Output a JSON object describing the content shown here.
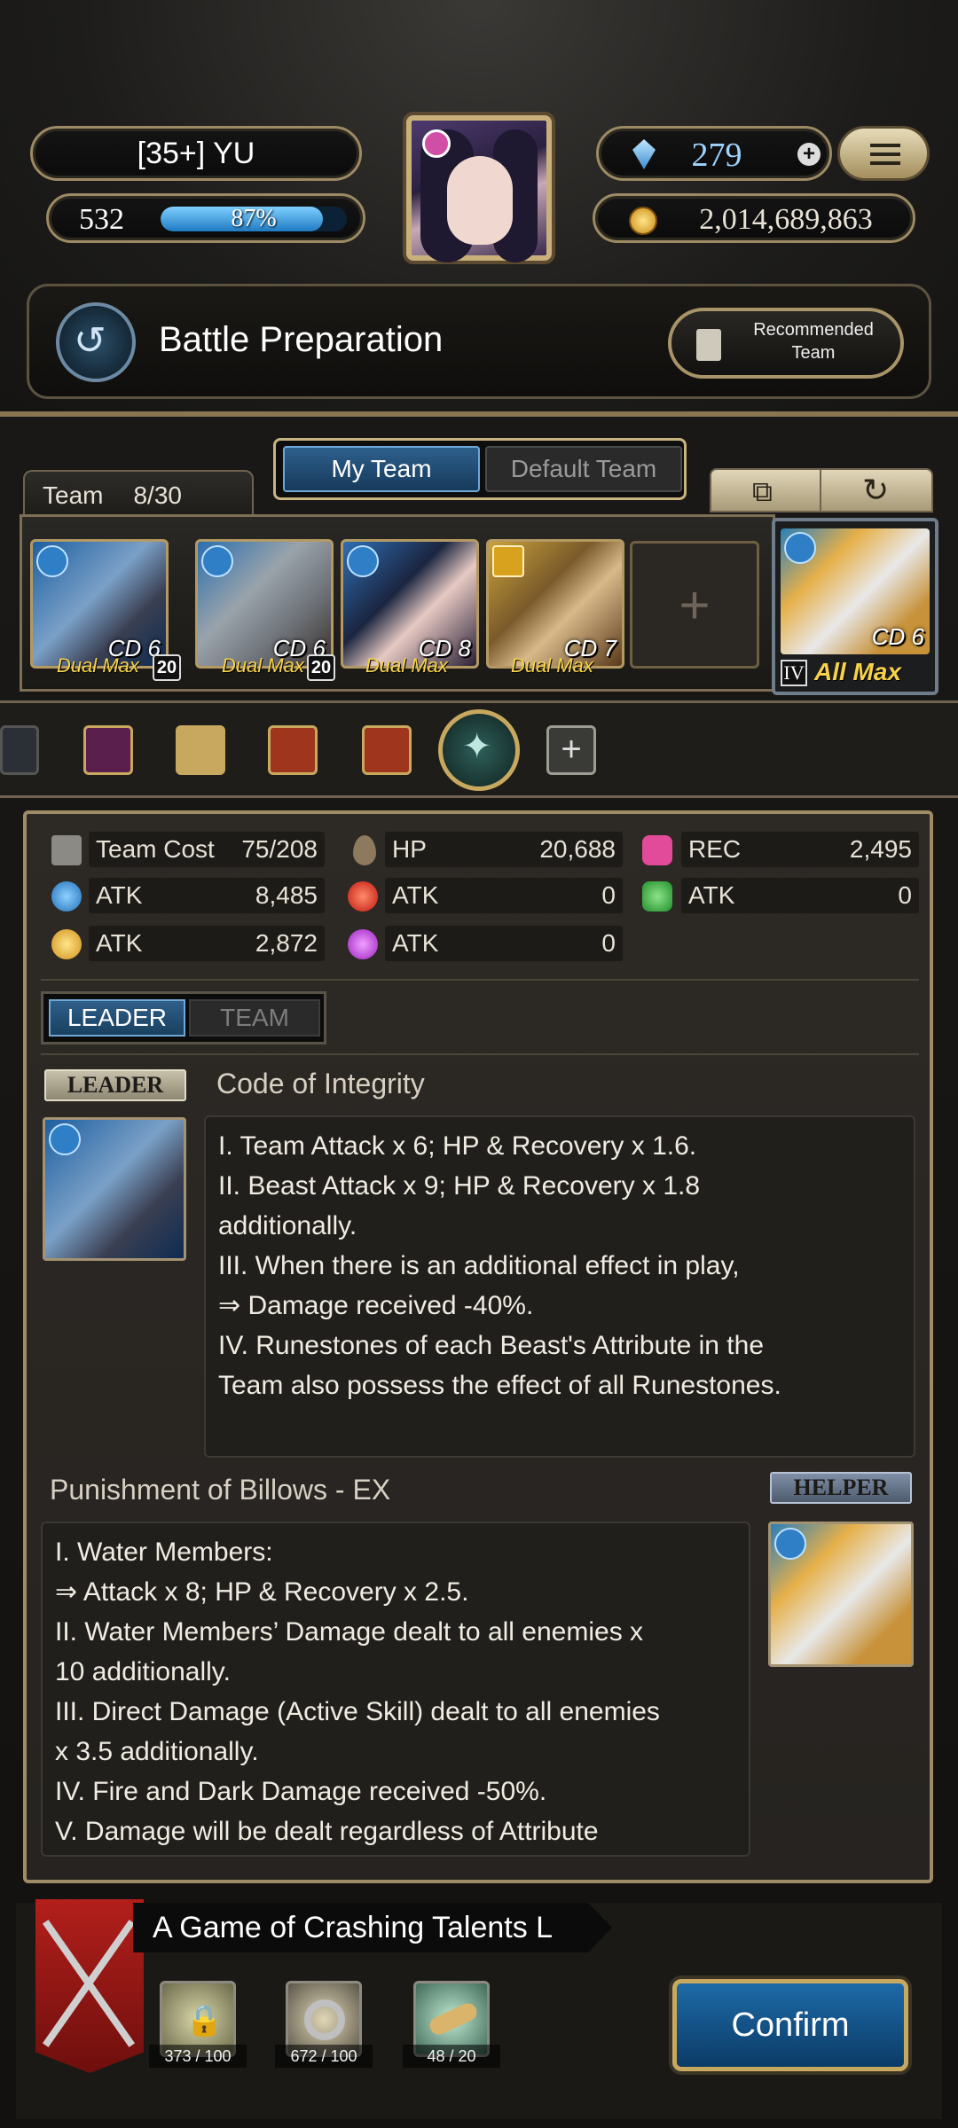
{
  "header": {
    "player_name": "[35+] YU",
    "level": "532",
    "exp_percent_text": "87%",
    "exp_fraction": 0.87,
    "gems": "279",
    "coins": "2,014,689,863",
    "screen_title": "Battle Preparation",
    "recommended_label_1": "Recommended",
    "recommended_label_2": "Team"
  },
  "tabs": {
    "my_team": "My Team",
    "default_team": "Default Team"
  },
  "team": {
    "label": "Team",
    "count": "8/30",
    "members": [
      {
        "cd": "CD 6",
        "tag": "Dual Max",
        "level": "20"
      },
      {
        "cd": "CD 6",
        "tag": "Dual Max",
        "level": "20"
      },
      {
        "cd": "CD 8",
        "tag": "Dual Max",
        "level": ""
      },
      {
        "cd": "CD 7",
        "tag": "Dual Max",
        "level": ""
      }
    ],
    "empty_slot_symbol": "+",
    "helper": {
      "cd": "CD 6",
      "rank": "IV",
      "tag": "All Max"
    }
  },
  "stats": {
    "team_cost_label": "Team Cost",
    "team_cost": "75/208",
    "hp_label": "HP",
    "hp": "20,688",
    "rec_label": "REC",
    "rec": "2,495",
    "atk_label": "ATK",
    "water_atk": "8,485",
    "fire_atk": "0",
    "earth_atk": "0",
    "light_atk": "2,872",
    "dark_atk": "0"
  },
  "skill_tabs": {
    "leader": "LEADER",
    "team": "TEAM"
  },
  "leader_skill": {
    "plate": "LEADER",
    "name": "Code of Integrity",
    "lines": [
      "I. Team Attack x 6; HP & Recovery x 1.6.",
      "II. Beast Attack x 9; HP & Recovery x 1.8",
      "additionally.",
      "III. When there is an additional effect in play,",
      "⇒ Damage received -40%.",
      "IV. Runestones of each Beast's Attribute in the",
      "Team also possess the effect of all Runestones."
    ]
  },
  "helper_skill": {
    "plate": "HELPER",
    "name": "Punishment of Billows - EX",
    "lines": [
      "I. Water Members:",
      "⇒ Attack x 8; HP & Recovery x 2.5.",
      "II. Water Members’ Damage dealt to all enemies x",
      "10 additionally.",
      "III. Direct Damage (Active Skill) dealt to all enemies",
      "x 3.5 additionally.",
      "IV. Fire and Dark Damage received -50%.",
      "V. Damage will be dealt regardless of Attribute"
    ]
  },
  "stage": {
    "title": "A Game of Crashing Talents L"
  },
  "items": [
    {
      "count": "373 / 100"
    },
    {
      "count": "672 / 100"
    },
    {
      "count": "48 / 20"
    }
  ],
  "confirm_label": "Confirm",
  "colors": {
    "accent_blue": "#1d6aa8",
    "gold_frame": "#c7a85e",
    "dual_max_yellow": "#f6d24a"
  }
}
